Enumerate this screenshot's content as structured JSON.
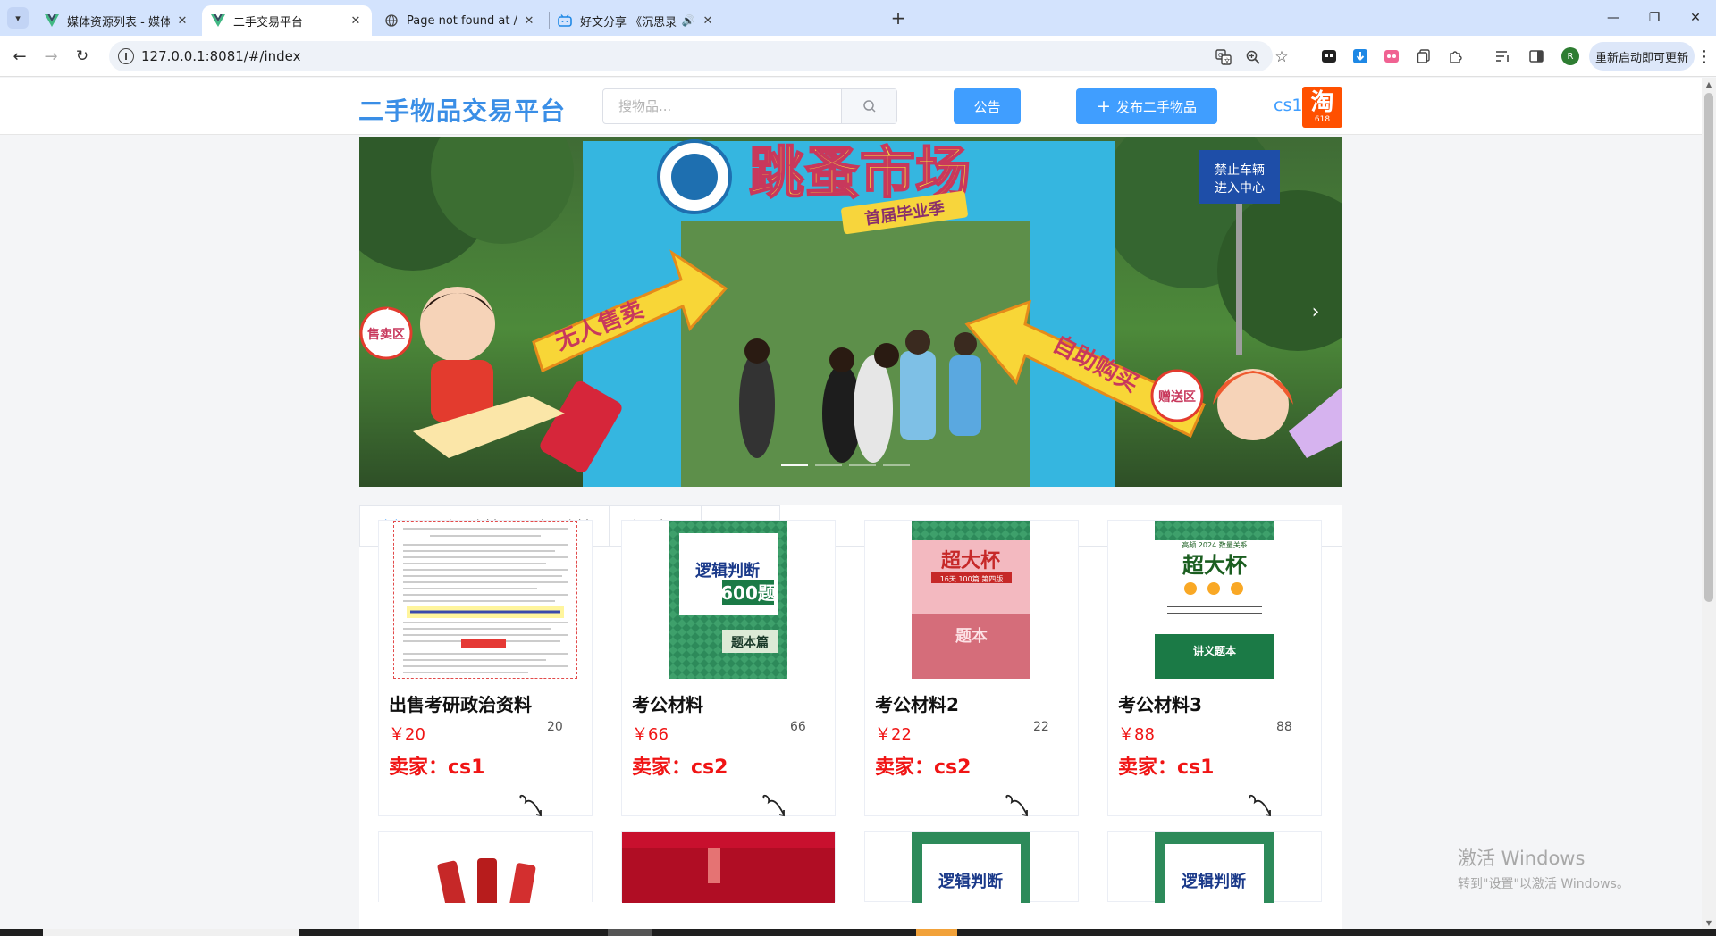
{
  "browser": {
    "tabs": [
      {
        "title": "媒体资源列表 - 媒体资源管理系",
        "icon": "vue-icon",
        "active": false
      },
      {
        "title": "二手交易平台",
        "icon": "vue-icon",
        "active": true
      },
      {
        "title": "Page not found at /",
        "icon": "globe-icon",
        "active": false
      },
      {
        "title": "好文分享 《沉思录：人生应",
        "icon": "bilibili-icon",
        "active": false
      }
    ],
    "url": "127.0.0.1:8081/#/index",
    "update_button": "重新启动即可更新",
    "profile_initial": "R",
    "accent_color": "#d3e3fd"
  },
  "site": {
    "logo": "二手物品交易平台",
    "search_placeholder": "搜物品...",
    "notice_button": "公告",
    "publish_button": "发布二手物品",
    "username": "cs1",
    "taobao_char": "淘",
    "taobao_num": "618",
    "brand_color": "#409eff",
    "price_color": "#f01414"
  },
  "carousel": {
    "banner_text": "跳蚤市场",
    "banner_sub": "首届毕业季",
    "sign_left": "无人售卖",
    "sign_right": "自助购买",
    "slide_count": 4,
    "active_slide": 0
  },
  "categories": [
    "全部",
    "考研资料",
    "考公资料",
    "电子产品",
    "日用品"
  ],
  "active_category": 0,
  "products": [
    {
      "title": "出售考研政治资料",
      "price": "￥20",
      "count": "20",
      "seller": "卖家：cs1",
      "cover_text": "",
      "thumb_kind": "doc"
    },
    {
      "title": "考公材料",
      "price": "￥66",
      "count": "66",
      "seller": "卖家：cs2",
      "cover_text": "逻辑判断",
      "cover_sub": "600题",
      "cover_foot": "题本篇",
      "thumb_kind": "book-green"
    },
    {
      "title": "考公材料2",
      "price": "￥22",
      "count": "22",
      "seller": "卖家：cs2",
      "cover_text": "超大杯",
      "cover_sub": "16天 100篇 第四版",
      "cover_foot": "题本",
      "thumb_kind": "book-red"
    },
    {
      "title": "考公材料3",
      "price": "￥88",
      "count": "88",
      "seller": "卖家：cs1",
      "cover_text": "超大杯",
      "cover_sub": "高频 2024 数量关系",
      "cover_foot": "讲义题本",
      "thumb_kind": "book-green2"
    }
  ],
  "second_row_cover_text": "逻辑判断",
  "windows_watermark": {
    "line1": "激活 Windows",
    "line2": "转到\"设置\"以激活 Windows。"
  }
}
